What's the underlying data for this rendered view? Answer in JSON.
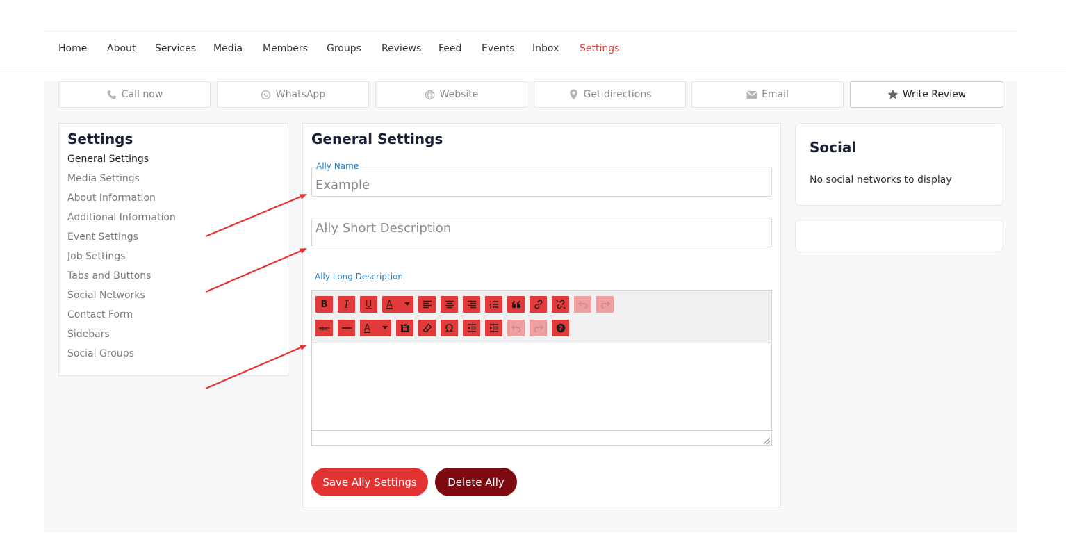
{
  "nav": {
    "items": [
      "Home",
      "About",
      "Services",
      "Media",
      "Members",
      "Groups",
      "Reviews",
      "Feed",
      "Events",
      "Inbox",
      "Settings"
    ],
    "active": "Settings"
  },
  "actions": {
    "call": "Call now",
    "whatsapp": "WhatsApp",
    "website": "Website",
    "directions": "Get directions",
    "email": "Email",
    "review": "Write Review"
  },
  "sidebar": {
    "title": "Settings",
    "items": [
      "General Settings",
      "Media Settings",
      "About Information",
      "Additional Information",
      "Event Settings",
      "Job Settings",
      "Tabs and Buttons",
      "Social Networks",
      "Contact Form",
      "Sidebars",
      "Social Groups"
    ],
    "active": "General Settings"
  },
  "form": {
    "title": "General Settings",
    "name_label": "Ally Name",
    "name_placeholder": "Example",
    "short_placeholder": "Ally Short Description",
    "long_label": "Ally Long Description",
    "save_label": "Save Ally Settings",
    "delete_label": "Delete Ally"
  },
  "social": {
    "title": "Social",
    "empty_text": "No social networks to display"
  },
  "colors": {
    "accent": "#e03a3a",
    "danger": "#7d0a10",
    "link": "#1e7ec8",
    "annotation_arrow": "#e8302e"
  }
}
